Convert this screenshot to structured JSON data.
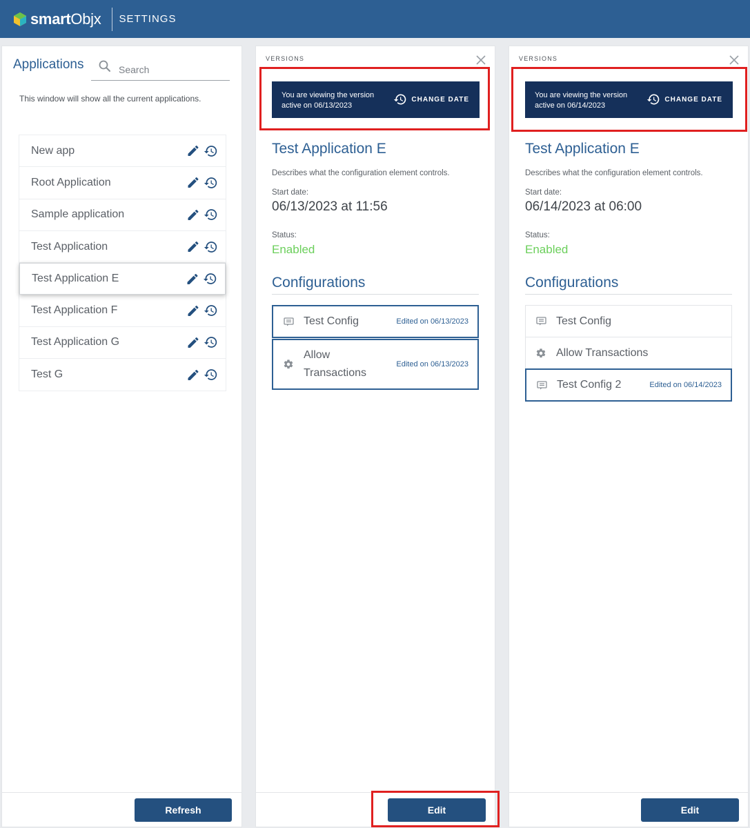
{
  "header": {
    "logo_bold": "smart",
    "logo_light": "Objx",
    "title": "SETTINGS"
  },
  "applications": {
    "title": "Applications",
    "search_placeholder": "Search",
    "description": "This window will show all the current applications.",
    "items": [
      {
        "label": "New app"
      },
      {
        "label": "Root Application"
      },
      {
        "label": "Sample application"
      },
      {
        "label": "Test Application"
      },
      {
        "label": "Test Application E",
        "selected": true
      },
      {
        "label": "Test Application F"
      },
      {
        "label": "Test Application G"
      },
      {
        "label": "Test G"
      }
    ],
    "refresh_label": "Refresh"
  },
  "version_left": {
    "section_label": "VERSIONS",
    "banner_text": "You are viewing the version active on 06/13/2023",
    "change_date_label": "CHANGE DATE",
    "app_title": "Test Application E",
    "description": "Describes what the configuration element controls.",
    "start_label": "Start date:",
    "start_value": "06/13/2023 at 11:56",
    "status_label": "Status:",
    "status_value": "Enabled",
    "configurations_title": "Configurations",
    "configurations": [
      {
        "label": "Test Config",
        "icon": "chat-icon",
        "edited": "Edited on 06/13/2023"
      },
      {
        "label": "Allow Transactions",
        "icon": "gear-icon",
        "edited": "Edited on 06/13/2023"
      }
    ],
    "edit_label": "Edit"
  },
  "version_right": {
    "section_label": "VERSIONS",
    "banner_text": "You are viewing the version active on 06/14/2023",
    "change_date_label": "CHANGE DATE",
    "app_title": "Test Application E",
    "description": "Describes what the configuration element controls.",
    "start_label": "Start date:",
    "start_value": "06/14/2023 at 06:00",
    "status_label": "Status:",
    "status_value": "Enabled",
    "configurations_title": "Configurations",
    "configurations": [
      {
        "label": "Test Config",
        "icon": "chat-icon",
        "edited": ""
      },
      {
        "label": "Allow Transactions",
        "icon": "gear-icon",
        "edited": ""
      },
      {
        "label": "Test Config 2",
        "icon": "chat-icon",
        "edited": "Edited on 06/14/2023"
      }
    ],
    "edit_label": "Edit"
  },
  "colors": {
    "header": "#2d5f93",
    "banner": "#15305a",
    "accent": "#2d5f93",
    "enabled": "#6bcf5b",
    "highlight": "#e02020"
  }
}
